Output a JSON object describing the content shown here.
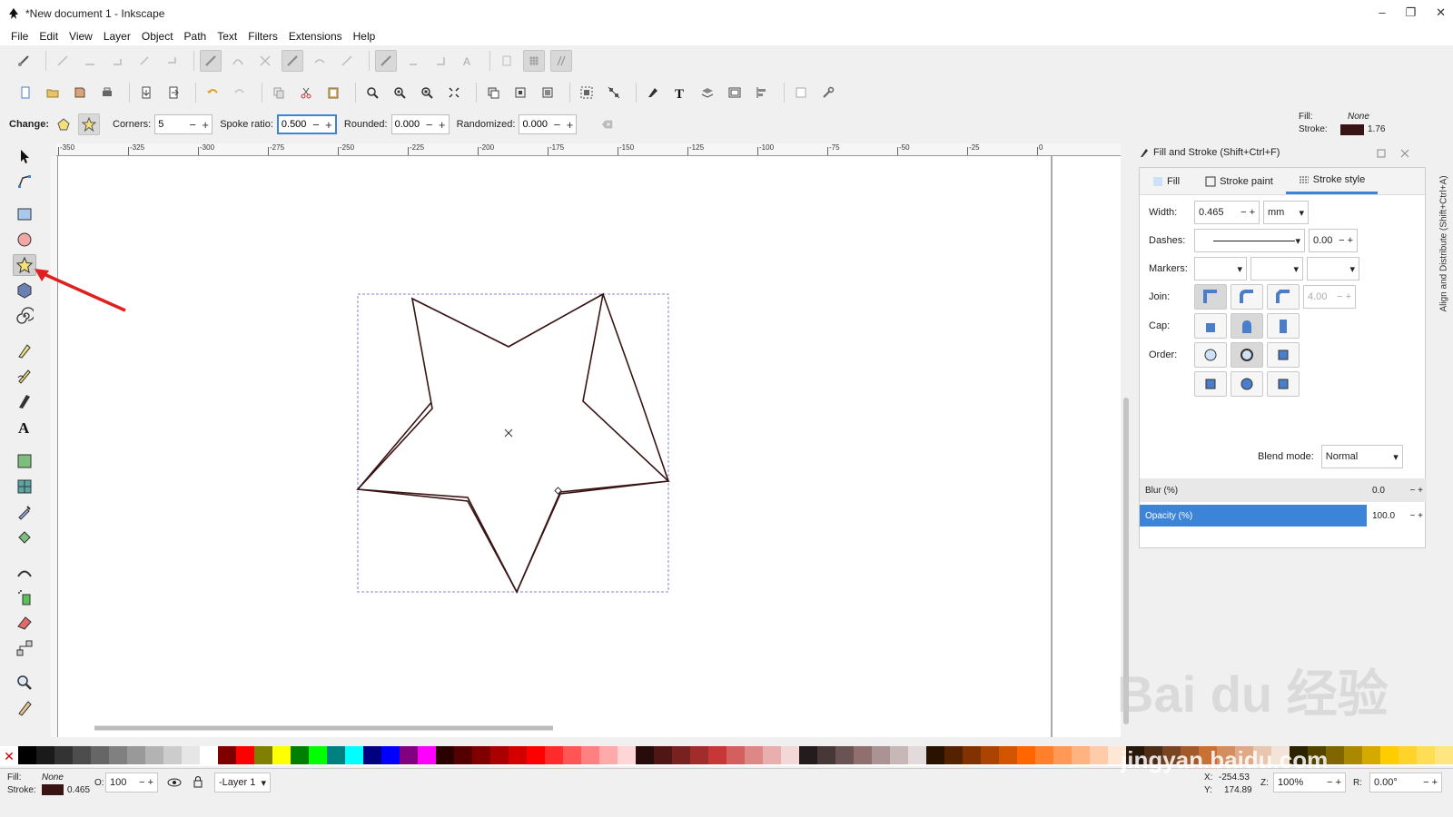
{
  "window": {
    "title": "*New document 1 - Inkscape",
    "min": "–",
    "max": "❐",
    "close": "✕"
  },
  "menu": [
    "File",
    "Edit",
    "View",
    "Layer",
    "Object",
    "Path",
    "Text",
    "Filters",
    "Extensions",
    "Help"
  ],
  "controls": {
    "change_label": "Change:",
    "corners_label": "Corners:",
    "corners_value": "5",
    "spoke_label": "Spoke ratio:",
    "spoke_value": "0.500",
    "rounded_label": "Rounded:",
    "rounded_value": "0.000",
    "randomized_label": "Randomized:",
    "randomized_value": "0.000"
  },
  "fill_indicator": {
    "fill_label": "Fill:",
    "fill_value": "None",
    "stroke_label": "Stroke:",
    "stroke_value": "1.76",
    "stroke_color": "#3a1414"
  },
  "ruler_ticks": [
    "-350",
    "-325",
    "-300",
    "-275",
    "-250",
    "-225",
    "-200",
    "-175",
    "-150",
    "-125",
    "-100",
    "-75",
    "-50",
    "-25",
    "0"
  ],
  "dock": {
    "title": "Fill and Stroke (Shift+Ctrl+F)",
    "tabs": [
      "Fill",
      "Stroke paint",
      "Stroke style"
    ],
    "width_label": "Width:",
    "width_value": "0.465",
    "width_unit": "mm",
    "dashes_label": "Dashes:",
    "dashes_offset": "0.00",
    "markers_label": "Markers:",
    "join_label": "Join:",
    "miter_value": "4.00",
    "cap_label": "Cap:",
    "order_label": "Order:",
    "blend_label": "Blend mode:",
    "blend_value": "Normal",
    "blur_label": "Blur (%)",
    "blur_value": "0.0",
    "opacity_label": "Opacity (%)",
    "opacity_value": "100.0"
  },
  "side_tab": "Align and Distribute (Shift+Ctrl+A)",
  "status": {
    "fill_label": "Fill:",
    "fill_value": "None",
    "stroke_label": "Stroke:",
    "stroke_value": "0.465",
    "opacity_label": "O:",
    "opacity_value": "100",
    "layer": "-Layer 1",
    "x_label": "X:",
    "x_value": "-254.53",
    "y_label": "Y:",
    "y_value": "174.89",
    "zoom_label": "Z:",
    "zoom_value": "100%",
    "rot_label": "R:",
    "rot_value": "0.00°"
  },
  "palette": [
    "#000000",
    "#1a1a1a",
    "#333333",
    "#4d4d4d",
    "#666666",
    "#808080",
    "#999999",
    "#b3b3b3",
    "#cccccc",
    "#e6e6e6",
    "#ffffff",
    "#800000",
    "#ff0000",
    "#808000",
    "#ffff00",
    "#008000",
    "#00ff00",
    "#008080",
    "#00ffff",
    "#000080",
    "#0000ff",
    "#800080",
    "#ff00ff",
    "#2b0000",
    "#550000",
    "#800000",
    "#aa0000",
    "#d40000",
    "#ff0000",
    "#ff2a2a",
    "#ff5555",
    "#ff8080",
    "#ffaaaa",
    "#ffd5d5",
    "#280b0b",
    "#501616",
    "#782121",
    "#a02c2c",
    "#c83737",
    "#d35f5f",
    "#de8787",
    "#e9afaf",
    "#f4d7d7",
    "#241c1c",
    "#483737",
    "#6c5353",
    "#916f6f",
    "#ac9393",
    "#c8b7b7",
    "#e3dbdb",
    "#2b1100",
    "#552200",
    "#803300",
    "#aa4400",
    "#d45500",
    "#ff6600",
    "#ff7f2a",
    "#ff9955",
    "#ffb380",
    "#ffccaa",
    "#ffe6d5",
    "#28170b",
    "#502d16",
    "#784421",
    "#a05a2c",
    "#c87137",
    "#d38d5f",
    "#deaa87",
    "#e9c6af",
    "#f4e3d7",
    "#2b2200",
    "#554400",
    "#806600",
    "#aa8800",
    "#d4aa00",
    "#ffcc00",
    "#ffd42a",
    "#ffdd55",
    "#ffe680"
  ],
  "watermark": "Bai du 经验",
  "watermark2": "jingyan.baidu.com"
}
